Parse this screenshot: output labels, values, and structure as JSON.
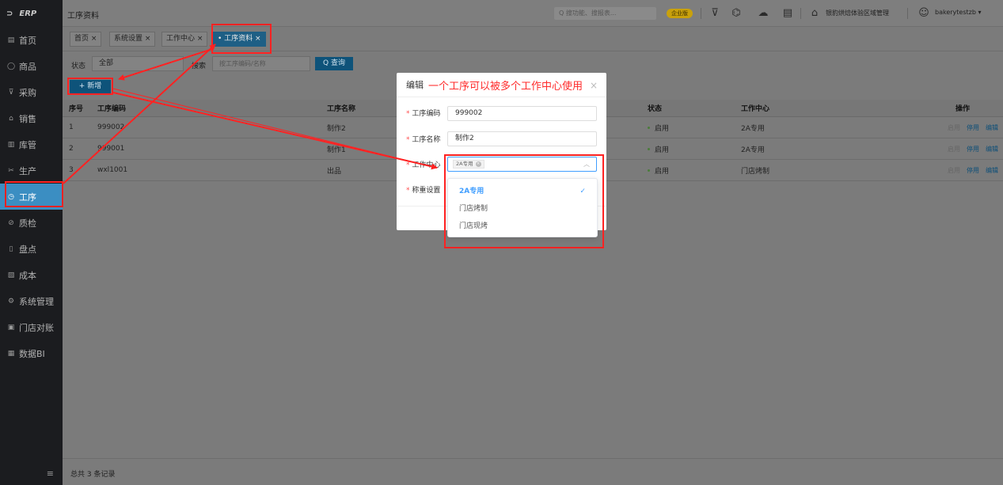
{
  "sidebar": {
    "logo": "ERP",
    "items": [
      {
        "label": "首页",
        "icon": "home-icon",
        "glyph": "▤"
      },
      {
        "label": "商品",
        "icon": "goods-icon",
        "glyph": "◯"
      },
      {
        "label": "采购",
        "icon": "cart-icon",
        "glyph": "⊽"
      },
      {
        "label": "销售",
        "icon": "sales-icon",
        "glyph": "⌂"
      },
      {
        "label": "库管",
        "icon": "warehouse-icon",
        "glyph": "▥"
      },
      {
        "label": "生产",
        "icon": "production-icon",
        "glyph": "✂"
      },
      {
        "label": "工序",
        "icon": "process-icon",
        "glyph": "◷"
      },
      {
        "label": "质检",
        "icon": "inspection-icon",
        "glyph": "⊘"
      },
      {
        "label": "盘点",
        "icon": "inventory-icon",
        "glyph": "▯"
      },
      {
        "label": "成本",
        "icon": "cost-icon",
        "glyph": "▧"
      },
      {
        "label": "系统管理",
        "icon": "settings-icon",
        "glyph": "⚙"
      },
      {
        "label": "门店对账",
        "icon": "reconcile-icon",
        "glyph": "▣"
      },
      {
        "label": "数据BI",
        "icon": "bi-icon",
        "glyph": "▦"
      }
    ],
    "collapse_glyph": "≡"
  },
  "header": {
    "title": "工序资料",
    "search_placeholder": "搜功能、搜报表...",
    "badge": "企业版",
    "store": "银豹烘焙体验区域管理",
    "user": "bakerytestzb ▾"
  },
  "tabs": [
    {
      "label": "首页 ×"
    },
    {
      "label": "系统设置 ×"
    },
    {
      "label": "工作中心 ×"
    },
    {
      "label": "• 工序资料 ×"
    }
  ],
  "filter": {
    "status_label": "状态",
    "status_value": "全部",
    "search_label": "搜索",
    "search_placeholder": "按工序编码/名称",
    "query_button": "Q 查询"
  },
  "add_button": "+ 新增",
  "table": {
    "headers": {
      "index": "序号",
      "code": "工序编码",
      "name": "工序名称",
      "status": "状态",
      "center": "工作中心",
      "ops": "操作"
    },
    "rows": [
      {
        "index": "1",
        "code": "999002",
        "name": "制作2",
        "status": "启用",
        "center": "2A专用",
        "op1": "启用",
        "op2": "停用",
        "op3": "编辑"
      },
      {
        "index": "2",
        "code": "999001",
        "name": "制作1",
        "status": "启用",
        "center": "2A专用",
        "op1": "启用",
        "op2": "停用",
        "op3": "编辑"
      },
      {
        "index": "3",
        "code": "wxl1001",
        "name": "出品",
        "status": "启用",
        "center": "门店烤制",
        "op1": "启用",
        "op2": "停用",
        "op3": "编辑"
      }
    ]
  },
  "footer": "总共 3 条记录",
  "modal": {
    "title": "编辑",
    "annotation": "一个工序可以被多个工作中心使用",
    "close": "×",
    "code_label": "工序编码",
    "code_value": "999002",
    "name_label": "工序名称",
    "name_value": "制作2",
    "center_label": "工作中心",
    "center_chip": "2A专用",
    "weigh_label": "称重设置",
    "required_mark": "*"
  },
  "dropdown": {
    "options": [
      {
        "label": "2A专用",
        "selected": true
      },
      {
        "label": "门店烤制",
        "selected": false
      },
      {
        "label": "门店现烤",
        "selected": false
      }
    ],
    "check": "✓"
  },
  "colors": {
    "accent": "#409eff",
    "annotation": "#ff2222",
    "active_nav": "#3b8ec2"
  }
}
